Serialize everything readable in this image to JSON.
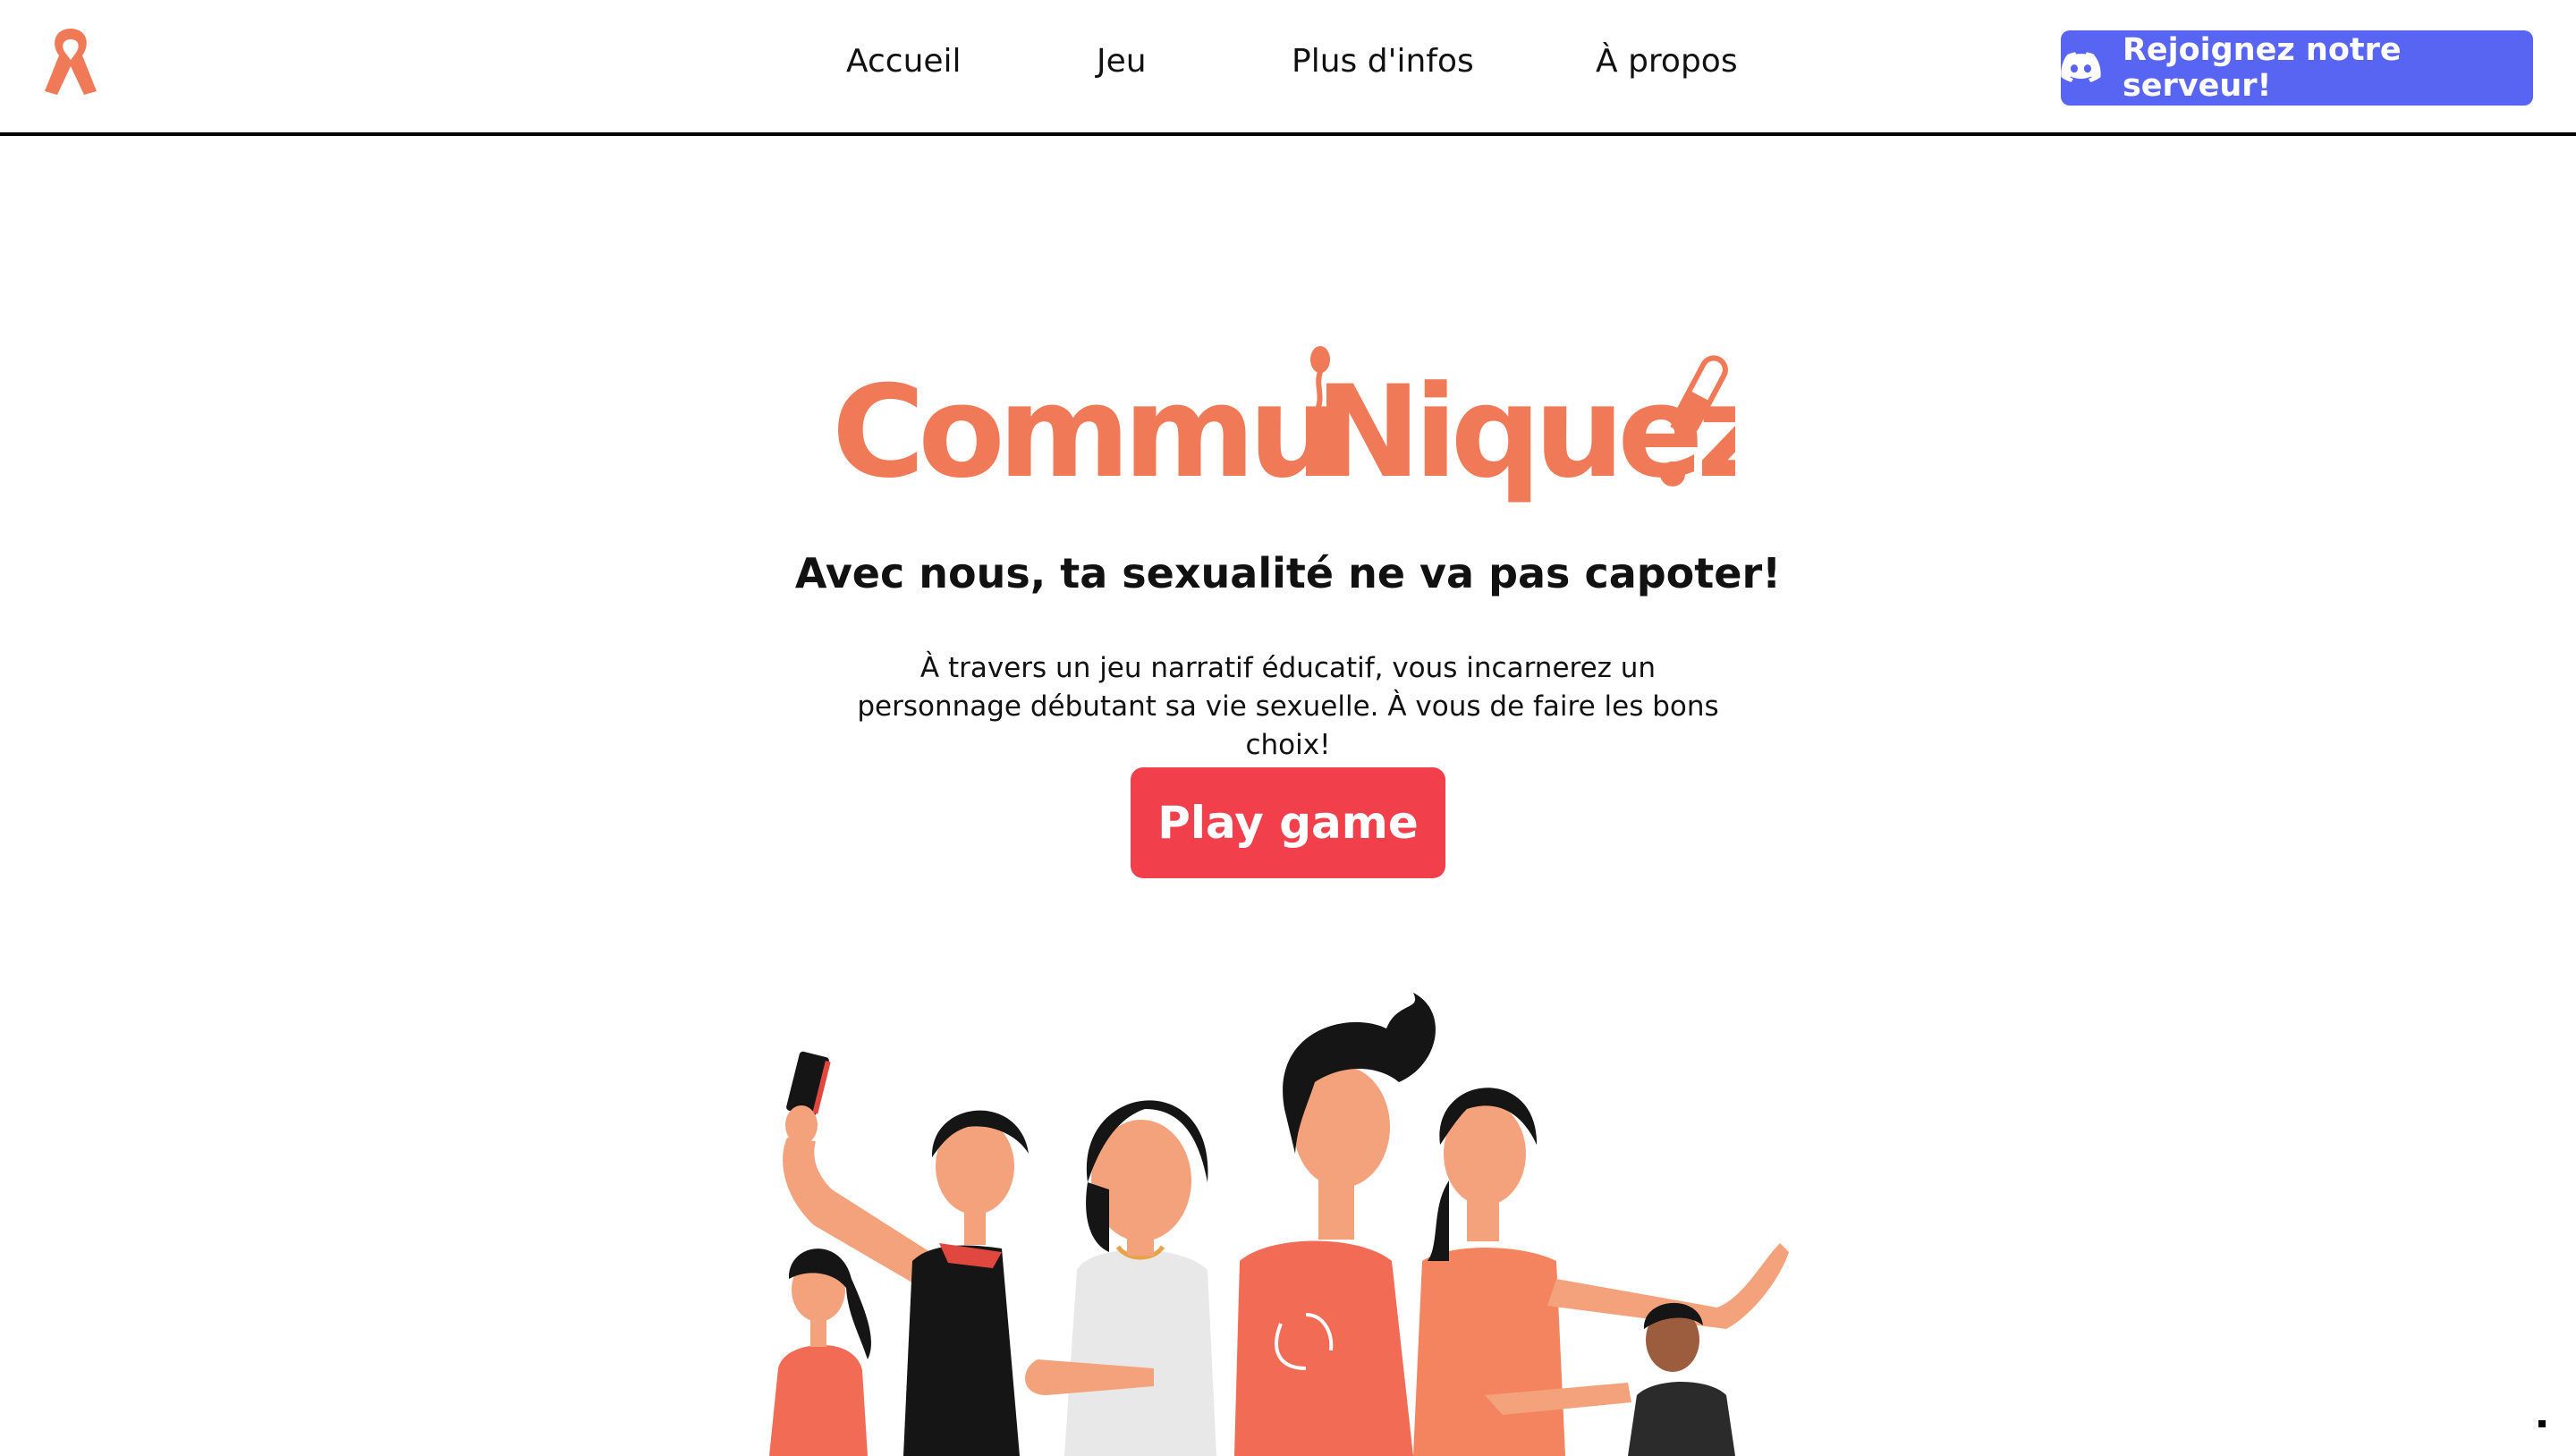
{
  "nav": {
    "logo_icon": "awareness-ribbon-icon",
    "links": [
      {
        "label": "Accueil"
      },
      {
        "label": "Jeu"
      },
      {
        "label": "Plus d'infos"
      },
      {
        "label": "À propos"
      }
    ],
    "discord_button": {
      "icon": "discord-icon",
      "label": "Rejoignez notre serveur!"
    }
  },
  "hero": {
    "brand_part1": "Commu",
    "brand_part2": "Niquez",
    "tagline": "Avec nous, ta sexualité ne va pas capoter!",
    "description": "À travers un jeu narratif éducatif, vous incarnerez un personnage débutant sa vie sexuelle. À vous de faire les bons choix!",
    "play_button": "Play game"
  },
  "colors": {
    "brand": "#f07a57",
    "play_button": "#f23f4c",
    "discord": "#5865f2",
    "nav_border": "#000000"
  }
}
